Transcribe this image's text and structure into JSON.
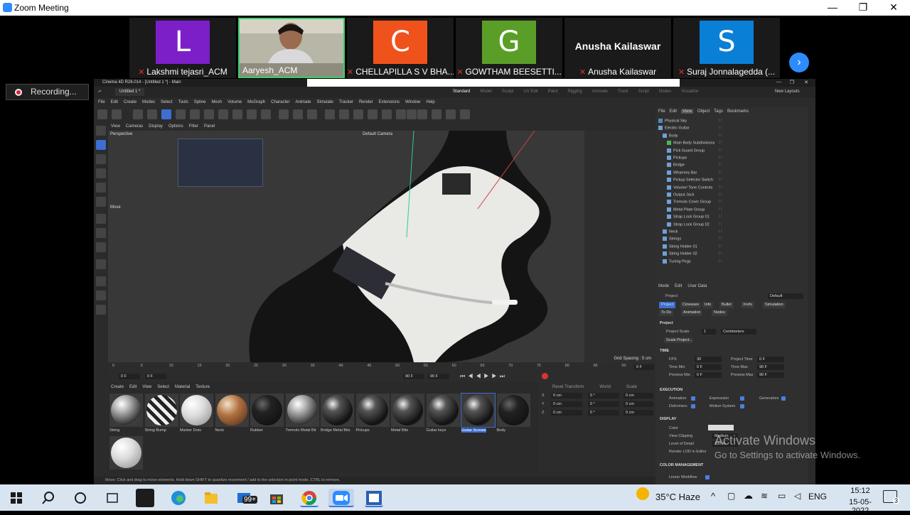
{
  "window": {
    "title": "Zoom Meeting",
    "controls": [
      "—",
      "❐",
      "✕"
    ]
  },
  "participants": [
    {
      "initial": "L",
      "name": "Lakshmi tejasri_ACM",
      "color": "#7d1fc9",
      "muted": true,
      "video": false
    },
    {
      "initial": "",
      "name": "Aaryesh_ACM",
      "color": "#8a8a7a",
      "muted": false,
      "video": true
    },
    {
      "initial": "C",
      "name": "CHELLAPILLA S V BHA...",
      "color": "#f0521c",
      "muted": true,
      "video": false
    },
    {
      "initial": "G",
      "name": "GOWTHAM BEESETTI...",
      "color": "#5a9e28",
      "muted": true,
      "video": false
    },
    {
      "initial": "",
      "display_name": "Anusha Kailaswar",
      "name": "Anusha Kailaswar",
      "color": "#1a1a1a",
      "muted": true,
      "video": false
    },
    {
      "initial": "S",
      "name": "Suraj Jonnalagedda (...",
      "color": "#0a7fd6",
      "muted": true,
      "video": false
    }
  ],
  "recording": {
    "label": "Recording..."
  },
  "c4d": {
    "title": "Cinema 4D R26.014 - [Untitled 1 *] - Main",
    "doc_tab": "Untitled 1 *",
    "layouts": [
      "Standard",
      "Model",
      "Sculpt",
      "UV Edit",
      "Paint",
      "Rigging",
      "Animate",
      "Track",
      "Script",
      "Nodes",
      "Visualize"
    ],
    "new_layouts": "New Layouts",
    "menu": [
      "File",
      "Edit",
      "Create",
      "Modes",
      "Select",
      "Tools",
      "Spline",
      "Mesh",
      "Volume",
      "MoGraph",
      "Character",
      "Animate",
      "Simulate",
      "Tracker",
      "Render",
      "Extensions",
      "Window",
      "Help"
    ],
    "viewport_menu": [
      "View",
      "Cameras",
      "Display",
      "Options",
      "Filter",
      "Panel"
    ],
    "viewport_label": "Perspective",
    "camera_label": "Default Camera",
    "move_label": "Move",
    "grid_spacing": "Grid Spacing : 5 cm",
    "object_menu": [
      "File",
      "Edit",
      "View",
      "Object",
      "Tags",
      "Bookmarks"
    ],
    "objects": [
      {
        "name": "Physical Sky",
        "indent": 0,
        "type": "sky"
      },
      {
        "name": "Electric Guitar",
        "indent": 0,
        "type": "null"
      },
      {
        "name": "Body",
        "indent": 1,
        "type": "null"
      },
      {
        "name": "Main Body Subdivisions",
        "indent": 2,
        "type": "green"
      },
      {
        "name": "Pick Guard Group",
        "indent": 2,
        "type": "null"
      },
      {
        "name": "Pickups",
        "indent": 2,
        "type": "null"
      },
      {
        "name": "Bridge",
        "indent": 2,
        "type": "null"
      },
      {
        "name": "Whammy Bar",
        "indent": 2,
        "type": "null"
      },
      {
        "name": "Pickup Selector Switch",
        "indent": 2,
        "type": "null"
      },
      {
        "name": "Volume/ Tone Controls",
        "indent": 2,
        "type": "null"
      },
      {
        "name": "Output Jack",
        "indent": 2,
        "type": "null"
      },
      {
        "name": "Tremolo Cover Group",
        "indent": 2,
        "type": "null"
      },
      {
        "name": "Metal Plate Group",
        "indent": 2,
        "type": "null"
      },
      {
        "name": "Strap Lock Group 01",
        "indent": 2,
        "type": "null"
      },
      {
        "name": "Strap Lock Group 02",
        "indent": 2,
        "type": "null"
      },
      {
        "name": "Neck",
        "indent": 1,
        "type": "null"
      },
      {
        "name": "Strings",
        "indent": 1,
        "type": "null"
      },
      {
        "name": "String Holder 01",
        "indent": 1,
        "type": "null"
      },
      {
        "name": "String Holder 02",
        "indent": 1,
        "type": "null"
      },
      {
        "name": "Tuning Pegs",
        "indent": 1,
        "type": "null"
      }
    ],
    "attr_menu": [
      "Mode",
      "Edit",
      "User Data"
    ],
    "attr_object": "Project",
    "attr_preset": "Default",
    "attr_tabs": [
      "Project",
      "Cineware",
      "Info",
      "Bullet",
      "Xrefs",
      "Simulation",
      "To Do",
      "Animation",
      "Nodes"
    ],
    "attr": {
      "heading": "Project",
      "scale_label": "Project Scale",
      "scale_value": "1",
      "scale_unit": "Centimeters",
      "scale_btn": "Scale Project...",
      "time_sec": "TIME",
      "fps_label": "FPS",
      "fps": "30",
      "ptime_label": "Project Time",
      "ptime": "0 F",
      "tmin_label": "Time Min",
      "tmin": "0 F",
      "tmax_label": "Time Max",
      "tmax": "90 F",
      "pmin_label": "Preview Min",
      "pmin": "0 F",
      "pmax_label": "Preview Max",
      "pmax": "90 F",
      "exec_sec": "EXECUTION",
      "anim_label": "Animation",
      "expr_label": "Expression",
      "gen_label": "Generators",
      "deform_label": "Deformers",
      "motion_label": "Motion System",
      "disp_sec": "DISPLAY",
      "color_label": "Color",
      "clip_label": "View Clipping",
      "clip_value": "Medium",
      "lod_label": "Level of Detail",
      "lod_value": "100 %",
      "render_lod_label": "Render LOD in Editor",
      "cm_sec": "COLOR MANAGEMENT",
      "linear_label": "Linear Workflow"
    },
    "timeline": {
      "ticks": [
        "0",
        "5",
        "10",
        "15",
        "20",
        "25",
        "30",
        "35",
        "40",
        "45",
        "50",
        "55",
        "60",
        "65",
        "70",
        "75",
        "80",
        "85",
        "90"
      ],
      "frame_start": "0 F",
      "frame_cur": "0 F",
      "frame_end": "90 F",
      "frame_end2": "90 F",
      "frame_right": "0 F"
    },
    "mat_menu": [
      "Create",
      "Edit",
      "View",
      "Select",
      "Material",
      "Texture"
    ],
    "materials": [
      {
        "name": "String",
        "style": "chrome"
      },
      {
        "name": "String Bump",
        "style": "stripe"
      },
      {
        "name": "Marker Dots",
        "style": "white"
      },
      {
        "name": "Neck",
        "style": "wood"
      },
      {
        "name": "Rubber",
        "style": "black"
      },
      {
        "name": "Tremolo Metal Bit",
        "style": "chrome"
      },
      {
        "name": "Bridge Metal Bits",
        "style": "darkchrome"
      },
      {
        "name": "Pickups",
        "style": "darkchrome"
      },
      {
        "name": "Metal Bits",
        "style": "darkchrome"
      },
      {
        "name": "Guitar keys",
        "style": "darkchrome"
      },
      {
        "name": "Guitar Screws",
        "style": "darkchrome",
        "selected": true
      },
      {
        "name": "Body",
        "style": "black"
      },
      {
        "name": "",
        "style": "white"
      }
    ],
    "coord_headers": [
      "Reset Transform",
      "World",
      "Scale"
    ],
    "coord_rows": [
      {
        "axis": "X",
        "p": "0 cm",
        "r": "0 °",
        "s": "0 cm"
      },
      {
        "axis": "Y",
        "p": "0 cm",
        "r": "0 °",
        "s": "0 cm"
      },
      {
        "axis": "Z",
        "p": "0 cm",
        "r": "0 °",
        "s": "0 cm"
      }
    ],
    "status": "Move: Click and drag to move elements. Hold down SHIFT to quantize movement / add to the selection in point mode, CTRL to remove."
  },
  "watermark": {
    "line1": "Activate Windows",
    "line2": "Go to Settings to activate Windows."
  },
  "taskbar": {
    "mail_badge": "99+",
    "weather": "35°C  Haze",
    "lang": "ENG",
    "time": "15:12",
    "date": "15-05-2022",
    "notif_count": "3"
  }
}
